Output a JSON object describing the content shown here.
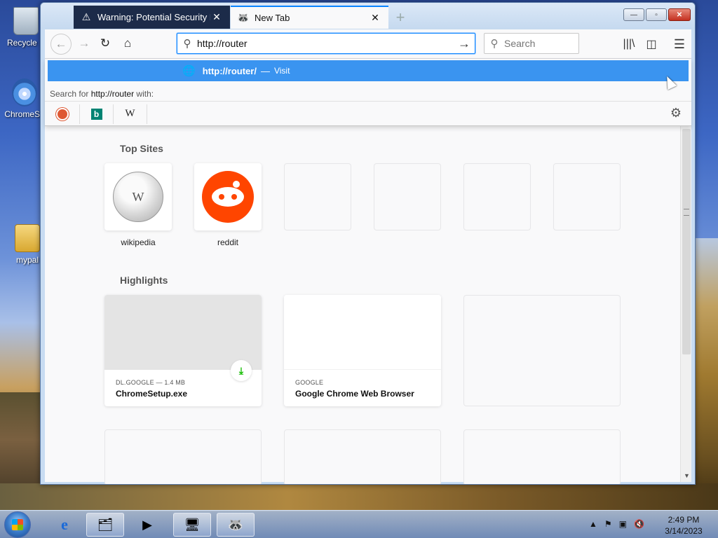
{
  "desktop": {
    "icons": [
      {
        "label": "Recycle B"
      },
      {
        "label": "ChromeSe"
      },
      {
        "label": "mypal"
      }
    ]
  },
  "browser": {
    "tabs": [
      {
        "label": "Warning: Potential Security Ris",
        "icon": "warning-icon",
        "active": false
      },
      {
        "label": "New Tab",
        "icon": "mypal-icon",
        "active": true
      }
    ],
    "new_tab_symbol": "+",
    "url_value": "http://router",
    "search_placeholder": "Search",
    "window_buttons": {
      "minimize": "—",
      "maximize": "▫",
      "close": "✕"
    }
  },
  "dropdown": {
    "suggestion_url": "http://router/",
    "suggestion_dash": "—",
    "suggestion_action": "Visit",
    "search_for_prefix": "Search for",
    "search_for_query": "http://router",
    "search_for_suffix": "with:",
    "engines": [
      "DuckDuckGo",
      "Bing",
      "Wikipedia"
    ],
    "wiki_letter": "W",
    "bing_letter": "b"
  },
  "newtab": {
    "top_sites_title": "Top Sites",
    "top_sites": [
      {
        "label": "wikipedia",
        "icon": "wikipedia-logo-icon"
      },
      {
        "label": "reddit",
        "icon": "reddit-logo-icon"
      },
      {
        "label": ""
      },
      {
        "label": ""
      },
      {
        "label": ""
      },
      {
        "label": ""
      }
    ],
    "highlights_title": "Highlights",
    "highlights": [
      {
        "meta": "DL.GOOGLE — 1.4 MB",
        "title": "ChromeSetup.exe",
        "badge": "download-icon"
      },
      {
        "meta": "GOOGLE",
        "title": "Google Chrome Web Browser",
        "badge": "clock-icon"
      }
    ]
  },
  "taskbar": {
    "clock_time": "2:49 PM",
    "clock_date": "3/14/2023"
  },
  "colors": {
    "accent": "#0a84ff",
    "suggestion_bg": "#3a94f0",
    "tab_dark": "#1c2b49",
    "reddit": "#ff4500",
    "download_green": "#12bc00"
  }
}
